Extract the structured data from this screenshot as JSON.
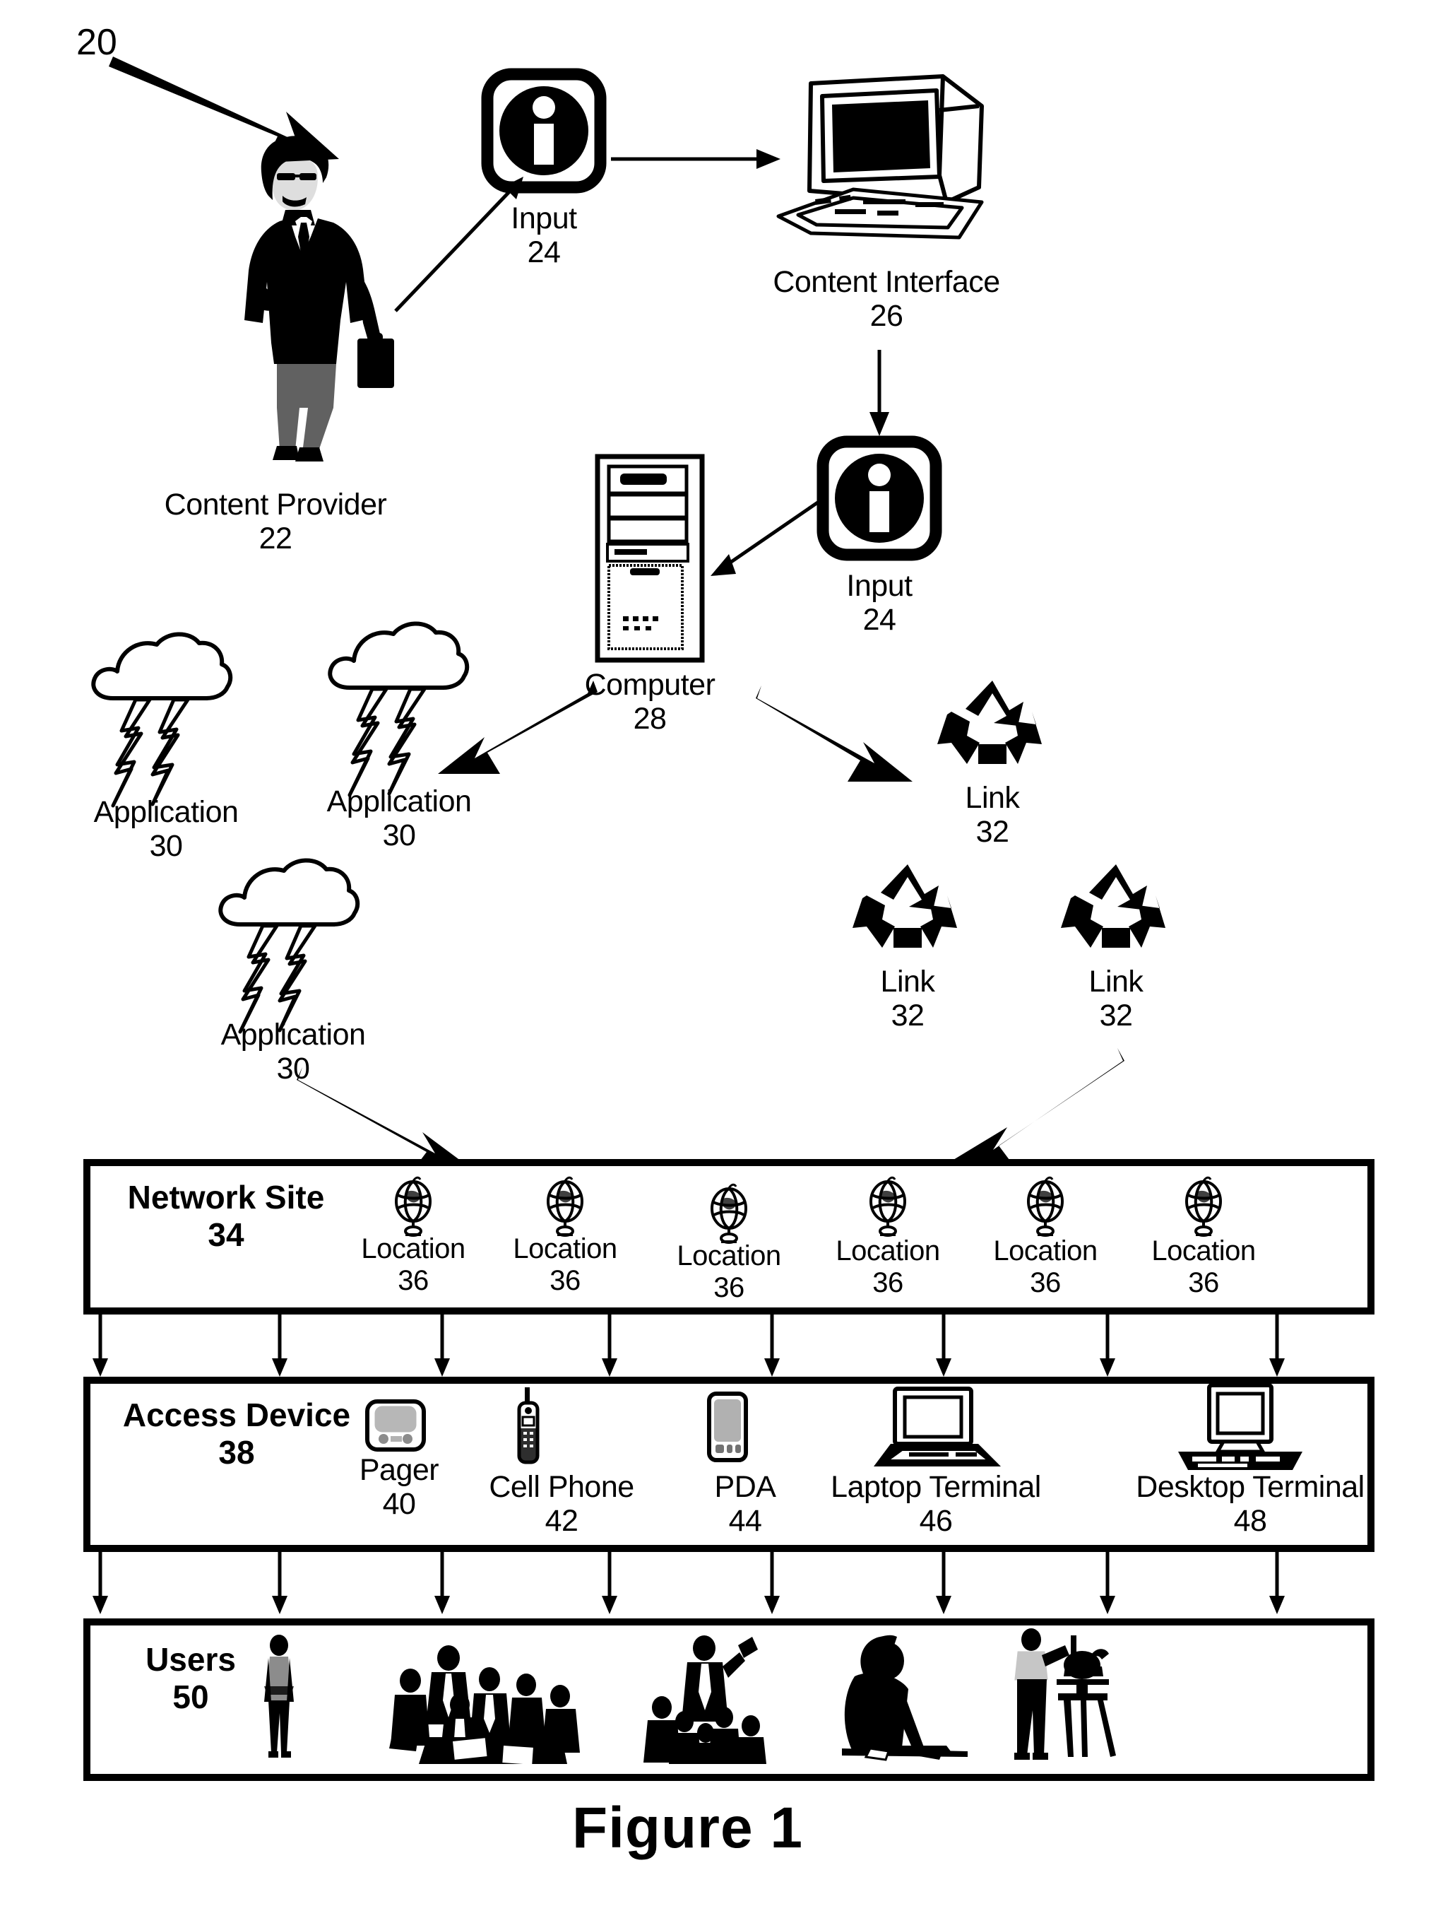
{
  "figure": {
    "caption": "Figure 1",
    "system_ref": "20"
  },
  "nodes": {
    "content_provider": {
      "label": "Content Provider",
      "ref": "22",
      "icon": "businessman-with-briefcase"
    },
    "input_top": {
      "label": "Input",
      "ref": "24",
      "icon": "information-icon"
    },
    "content_interface": {
      "label": "Content Interface",
      "ref": "26",
      "icon": "crt-monitor-keyboard-icon"
    },
    "input_mid": {
      "label": "Input",
      "ref": "24",
      "icon": "information-icon"
    },
    "computer": {
      "label": "Computer",
      "ref": "28",
      "icon": "tower-computer-icon"
    },
    "applications": [
      {
        "label": "Application",
        "ref": "30",
        "icon": "storm-cloud-lightning-icon"
      },
      {
        "label": "Application",
        "ref": "30",
        "icon": "storm-cloud-lightning-icon"
      },
      {
        "label": "Application",
        "ref": "30",
        "icon": "storm-cloud-lightning-icon"
      }
    ],
    "links": [
      {
        "label": "Link",
        "ref": "32",
        "icon": "recycle-arrows-icon"
      },
      {
        "label": "Link",
        "ref": "32",
        "icon": "recycle-arrows-icon"
      },
      {
        "label": "Link",
        "ref": "32",
        "icon": "recycle-arrows-icon"
      }
    ]
  },
  "rows": {
    "network_site": {
      "title": "Network Site",
      "ref": "34",
      "locations": [
        {
          "label": "Location",
          "ref": "36",
          "icon": "globe-on-stand-icon"
        },
        {
          "label": "Location",
          "ref": "36",
          "icon": "globe-on-stand-icon"
        },
        {
          "label": "Location",
          "ref": "36",
          "icon": "globe-on-stand-icon"
        },
        {
          "label": "Location",
          "ref": "36",
          "icon": "globe-on-stand-icon"
        },
        {
          "label": "Location",
          "ref": "36",
          "icon": "globe-on-stand-icon"
        },
        {
          "label": "Location",
          "ref": "36",
          "icon": "globe-on-stand-icon"
        }
      ]
    },
    "access_device": {
      "title": "Access Device",
      "ref": "38",
      "devices": [
        {
          "label": "Pager",
          "ref": "40",
          "icon": "pager-icon"
        },
        {
          "label": "Cell Phone",
          "ref": "42",
          "icon": "cell-phone-icon"
        },
        {
          "label": "PDA",
          "ref": "44",
          "icon": "pda-icon"
        },
        {
          "label": "Laptop Terminal",
          "ref": "46",
          "icon": "laptop-icon"
        },
        {
          "label": "Desktop Terminal",
          "ref": "48",
          "icon": "desktop-computer-icon"
        }
      ]
    },
    "users": {
      "title": "Users",
      "ref": "50",
      "groups": [
        {
          "icon": "standing-person-icon"
        },
        {
          "icon": "meeting-group-icon"
        },
        {
          "icon": "crowd-speaker-icon"
        },
        {
          "icon": "person-leaning-over-desk-icon"
        },
        {
          "icon": "person-with-tripod-icon"
        }
      ]
    }
  },
  "colors": {
    "ink": "#000000",
    "paper": "#ffffff"
  }
}
